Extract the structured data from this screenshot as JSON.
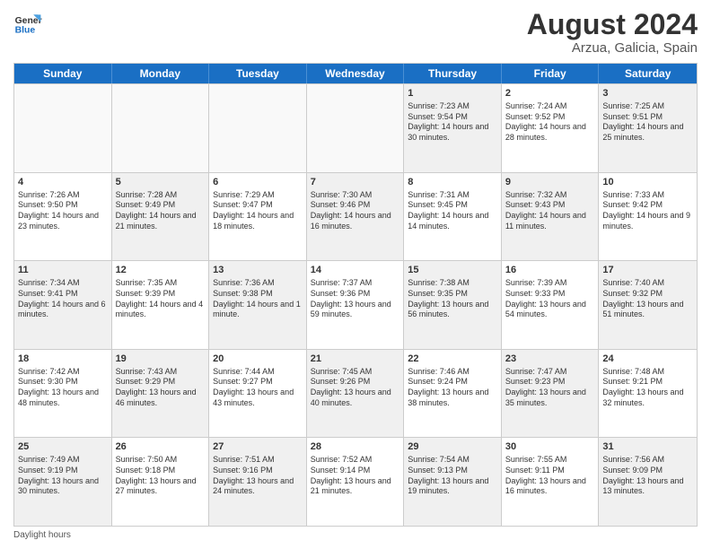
{
  "header": {
    "logo_general": "General",
    "logo_blue": "Blue",
    "month_title": "August 2024",
    "location": "Arzua, Galicia, Spain"
  },
  "weekdays": [
    "Sunday",
    "Monday",
    "Tuesday",
    "Wednesday",
    "Thursday",
    "Friday",
    "Saturday"
  ],
  "rows": [
    [
      {
        "day": "",
        "text": "",
        "empty": true
      },
      {
        "day": "",
        "text": "",
        "empty": true
      },
      {
        "day": "",
        "text": "",
        "empty": true
      },
      {
        "day": "",
        "text": "",
        "empty": true
      },
      {
        "day": "1",
        "text": "Sunrise: 7:23 AM\nSunset: 9:54 PM\nDaylight: 14 hours and 30 minutes.",
        "shaded": true
      },
      {
        "day": "2",
        "text": "Sunrise: 7:24 AM\nSunset: 9:52 PM\nDaylight: 14 hours and 28 minutes.",
        "shaded": false
      },
      {
        "day": "3",
        "text": "Sunrise: 7:25 AM\nSunset: 9:51 PM\nDaylight: 14 hours and 25 minutes.",
        "shaded": true
      }
    ],
    [
      {
        "day": "4",
        "text": "Sunrise: 7:26 AM\nSunset: 9:50 PM\nDaylight: 14 hours and 23 minutes.",
        "shaded": false
      },
      {
        "day": "5",
        "text": "Sunrise: 7:28 AM\nSunset: 9:49 PM\nDaylight: 14 hours and 21 minutes.",
        "shaded": true
      },
      {
        "day": "6",
        "text": "Sunrise: 7:29 AM\nSunset: 9:47 PM\nDaylight: 14 hours and 18 minutes.",
        "shaded": false
      },
      {
        "day": "7",
        "text": "Sunrise: 7:30 AM\nSunset: 9:46 PM\nDaylight: 14 hours and 16 minutes.",
        "shaded": true
      },
      {
        "day": "8",
        "text": "Sunrise: 7:31 AM\nSunset: 9:45 PM\nDaylight: 14 hours and 14 minutes.",
        "shaded": false
      },
      {
        "day": "9",
        "text": "Sunrise: 7:32 AM\nSunset: 9:43 PM\nDaylight: 14 hours and 11 minutes.",
        "shaded": true
      },
      {
        "day": "10",
        "text": "Sunrise: 7:33 AM\nSunset: 9:42 PM\nDaylight: 14 hours and 9 minutes.",
        "shaded": false
      }
    ],
    [
      {
        "day": "11",
        "text": "Sunrise: 7:34 AM\nSunset: 9:41 PM\nDaylight: 14 hours and 6 minutes.",
        "shaded": true
      },
      {
        "day": "12",
        "text": "Sunrise: 7:35 AM\nSunset: 9:39 PM\nDaylight: 14 hours and 4 minutes.",
        "shaded": false
      },
      {
        "day": "13",
        "text": "Sunrise: 7:36 AM\nSunset: 9:38 PM\nDaylight: 14 hours and 1 minute.",
        "shaded": true
      },
      {
        "day": "14",
        "text": "Sunrise: 7:37 AM\nSunset: 9:36 PM\nDaylight: 13 hours and 59 minutes.",
        "shaded": false
      },
      {
        "day": "15",
        "text": "Sunrise: 7:38 AM\nSunset: 9:35 PM\nDaylight: 13 hours and 56 minutes.",
        "shaded": true
      },
      {
        "day": "16",
        "text": "Sunrise: 7:39 AM\nSunset: 9:33 PM\nDaylight: 13 hours and 54 minutes.",
        "shaded": false
      },
      {
        "day": "17",
        "text": "Sunrise: 7:40 AM\nSunset: 9:32 PM\nDaylight: 13 hours and 51 minutes.",
        "shaded": true
      }
    ],
    [
      {
        "day": "18",
        "text": "Sunrise: 7:42 AM\nSunset: 9:30 PM\nDaylight: 13 hours and 48 minutes.",
        "shaded": false
      },
      {
        "day": "19",
        "text": "Sunrise: 7:43 AM\nSunset: 9:29 PM\nDaylight: 13 hours and 46 minutes.",
        "shaded": true
      },
      {
        "day": "20",
        "text": "Sunrise: 7:44 AM\nSunset: 9:27 PM\nDaylight: 13 hours and 43 minutes.",
        "shaded": false
      },
      {
        "day": "21",
        "text": "Sunrise: 7:45 AM\nSunset: 9:26 PM\nDaylight: 13 hours and 40 minutes.",
        "shaded": true
      },
      {
        "day": "22",
        "text": "Sunrise: 7:46 AM\nSunset: 9:24 PM\nDaylight: 13 hours and 38 minutes.",
        "shaded": false
      },
      {
        "day": "23",
        "text": "Sunrise: 7:47 AM\nSunset: 9:23 PM\nDaylight: 13 hours and 35 minutes.",
        "shaded": true
      },
      {
        "day": "24",
        "text": "Sunrise: 7:48 AM\nSunset: 9:21 PM\nDaylight: 13 hours and 32 minutes.",
        "shaded": false
      }
    ],
    [
      {
        "day": "25",
        "text": "Sunrise: 7:49 AM\nSunset: 9:19 PM\nDaylight: 13 hours and 30 minutes.",
        "shaded": true
      },
      {
        "day": "26",
        "text": "Sunrise: 7:50 AM\nSunset: 9:18 PM\nDaylight: 13 hours and 27 minutes.",
        "shaded": false
      },
      {
        "day": "27",
        "text": "Sunrise: 7:51 AM\nSunset: 9:16 PM\nDaylight: 13 hours and 24 minutes.",
        "shaded": true
      },
      {
        "day": "28",
        "text": "Sunrise: 7:52 AM\nSunset: 9:14 PM\nDaylight: 13 hours and 21 minutes.",
        "shaded": false
      },
      {
        "day": "29",
        "text": "Sunrise: 7:54 AM\nSunset: 9:13 PM\nDaylight: 13 hours and 19 minutes.",
        "shaded": true
      },
      {
        "day": "30",
        "text": "Sunrise: 7:55 AM\nSunset: 9:11 PM\nDaylight: 13 hours and 16 minutes.",
        "shaded": false
      },
      {
        "day": "31",
        "text": "Sunrise: 7:56 AM\nSunset: 9:09 PM\nDaylight: 13 hours and 13 minutes.",
        "shaded": true
      }
    ]
  ],
  "footer": {
    "note": "Daylight hours"
  }
}
